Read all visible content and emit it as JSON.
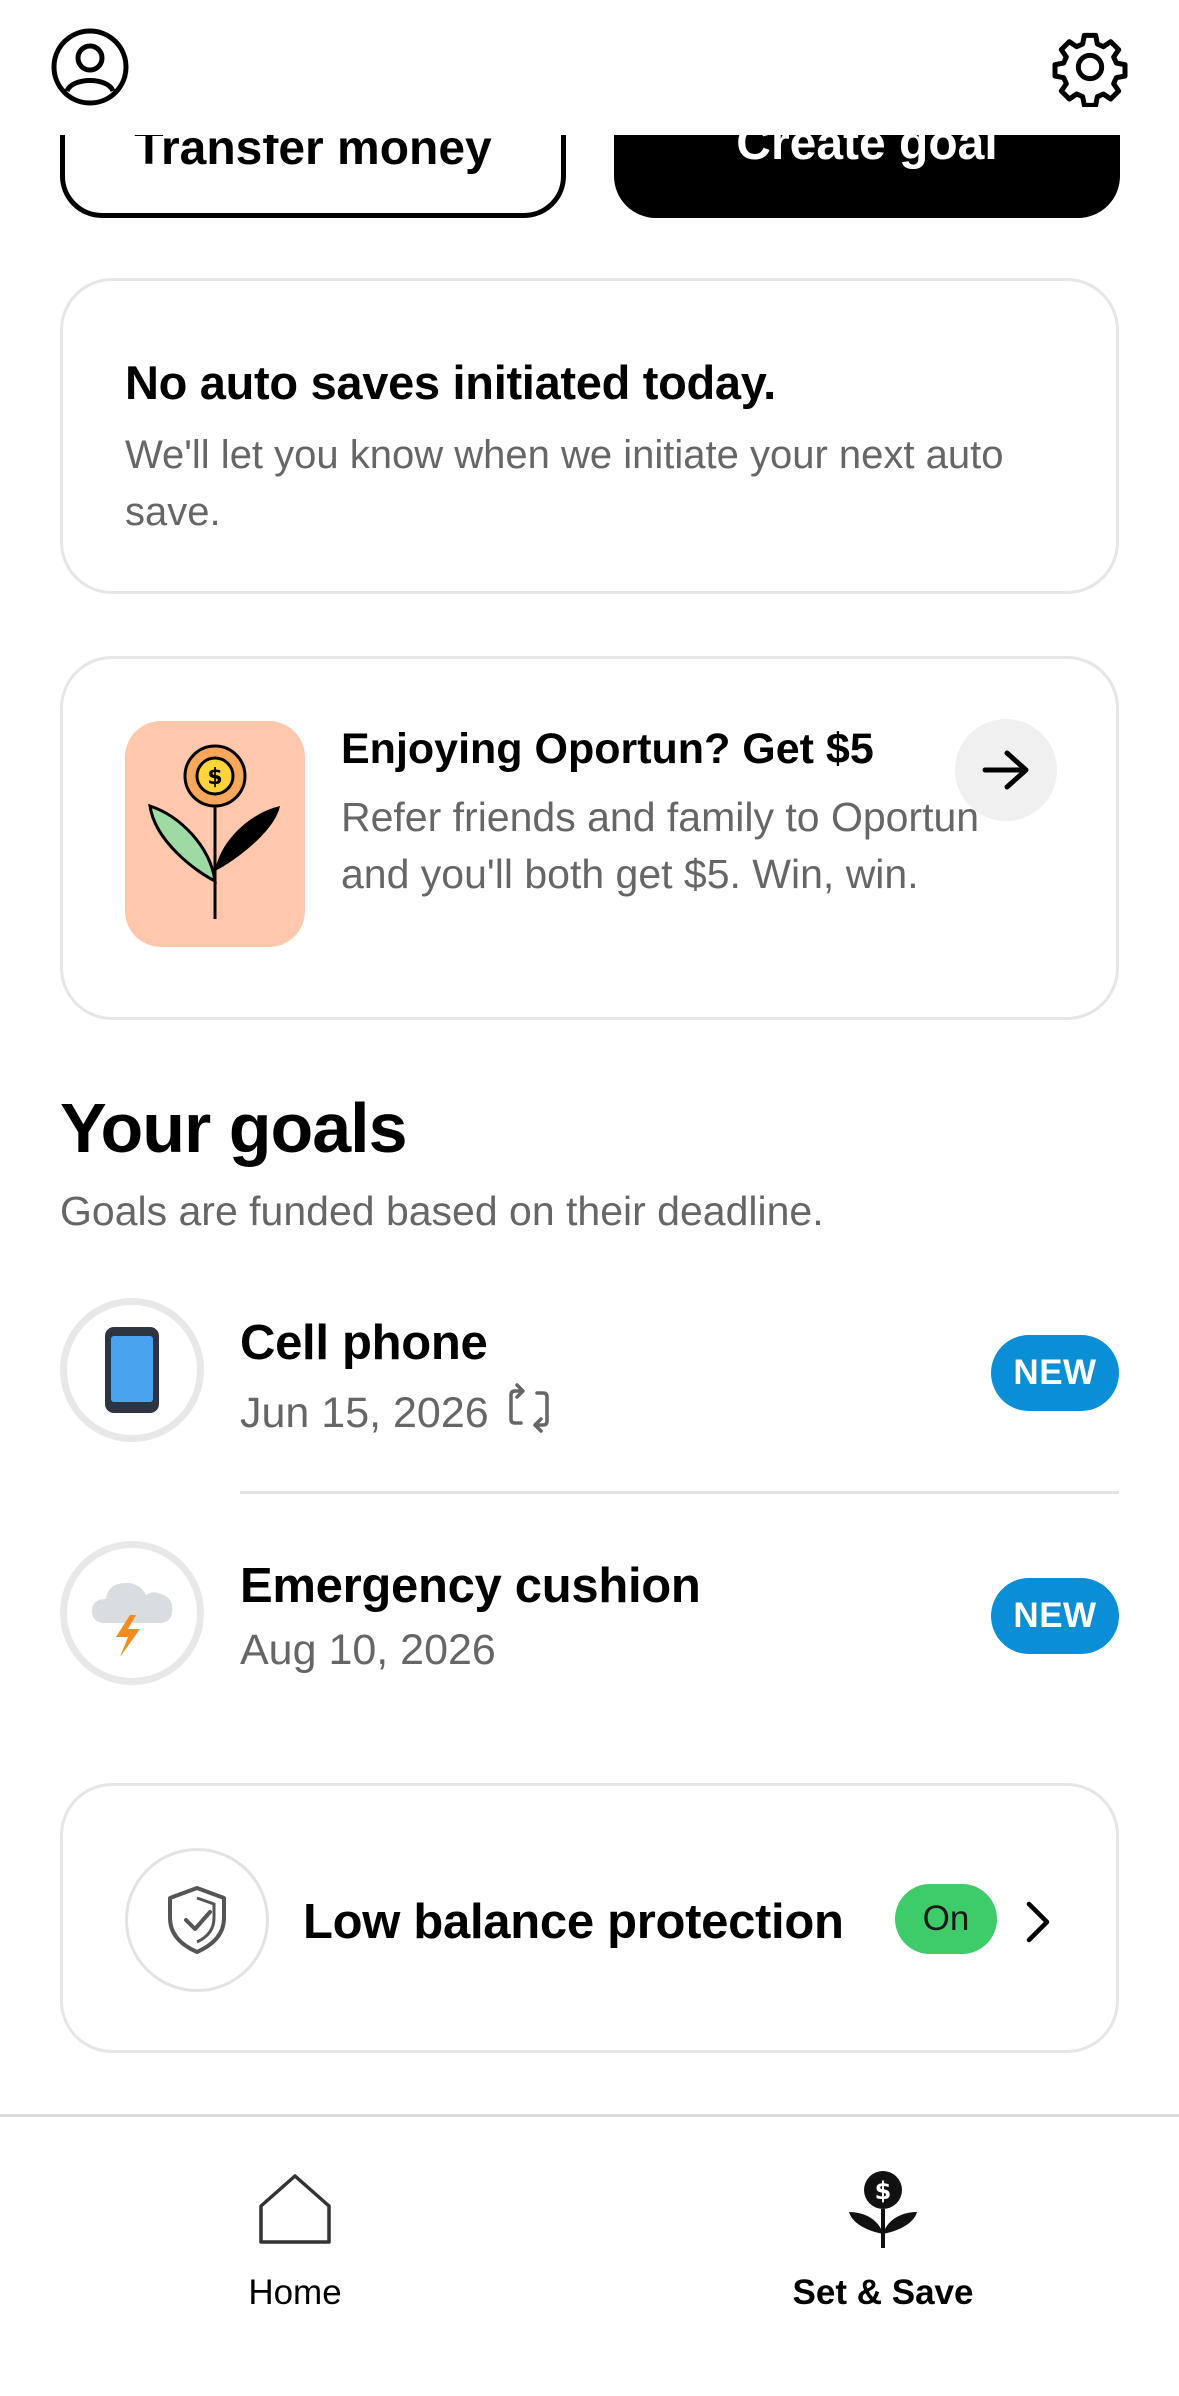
{
  "header": {
    "profile_icon": "profile-icon",
    "settings_icon": "gear-icon"
  },
  "actions": {
    "transfer_label": "Transfer money",
    "create_label": "Create goal"
  },
  "autosave_card": {
    "title": "No auto saves initiated today.",
    "body": "We'll let you know when we initiate your next auto save."
  },
  "referral_card": {
    "title": "Enjoying Oportun? Get $5",
    "body": "Refer friends and family to Oportun and you'll both get $5. Win, win.",
    "art_icon": "flower-dollar-icon",
    "arrow_icon": "arrow-right-icon"
  },
  "goals": {
    "title": "Your goals",
    "subtitle": "Goals are funded based on their deadline.",
    "items": [
      {
        "name": "Cell phone",
        "date": "Jun 15, 2026",
        "badge": "NEW",
        "icon": "phone-icon",
        "recurring": true
      },
      {
        "name": "Emergency cushion",
        "date": "Aug 10, 2026",
        "badge": "NEW",
        "icon": "storm-cloud-icon",
        "recurring": false
      }
    ]
  },
  "low_balance": {
    "label": "Low balance protection",
    "toggle": "On",
    "icon": "shield-check-icon"
  },
  "bottom_nav": {
    "items": [
      {
        "label": "Home",
        "icon": "home-icon",
        "active": false
      },
      {
        "label": "Set & Save",
        "icon": "money-plant-icon",
        "active": true
      }
    ]
  },
  "colors": {
    "badge_blue": "#0a8fd6",
    "toggle_green": "#3ecc6a",
    "referral_bg": "#ffc8ad",
    "muted_text": "#666666"
  }
}
